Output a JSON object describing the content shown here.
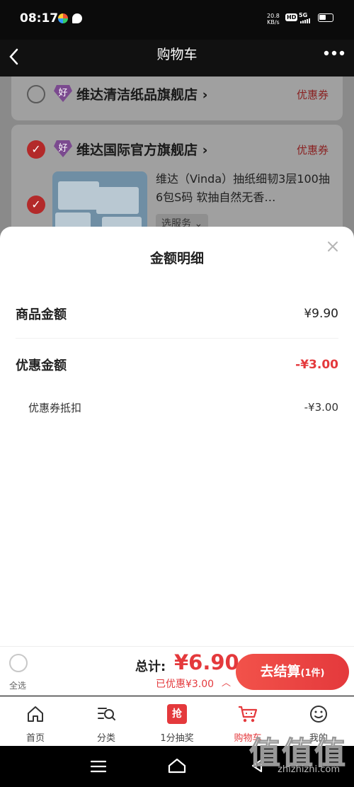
{
  "status_bar": {
    "time": "08:17",
    "network_speed": "20.8",
    "speed_unit": "KB/s",
    "hd_badge": "HD",
    "network_type": "5G"
  },
  "header": {
    "back_icon": "chevron-left-icon",
    "title": "购物车",
    "more_icon": "more-dots-icon"
  },
  "cart": {
    "shops": [
      {
        "name": "维达清洁纸品旗舰店",
        "badge": "好",
        "coupon": "优惠券",
        "selected": false
      },
      {
        "name": "维达国际官方旗舰店",
        "badge": "好",
        "coupon": "优惠券",
        "selected": true
      }
    ],
    "product": {
      "title": "维达（Vinda）抽纸细韧3层100抽6包S码 软抽自然无香…",
      "service_label": "选服务"
    }
  },
  "amount_sheet": {
    "title": "金额明细",
    "close_icon": "close-icon",
    "goods_label": "商品金额",
    "goods_value": "¥9.90",
    "discount_label": "优惠金额",
    "discount_value": "-¥3.00",
    "coupon_label": "优惠券抵扣",
    "coupon_value": "-¥3.00"
  },
  "checkout_bar": {
    "select_all_label": "全选",
    "total_label": "总计:",
    "total_value": "¥6.90",
    "discount_text": "已优惠¥3.00",
    "checkout_label": "去结算",
    "checkout_count": "(1件)"
  },
  "tab_bar": {
    "items": [
      {
        "label": "首页",
        "icon": "home-icon"
      },
      {
        "label": "分类",
        "icon": "category-search-icon"
      },
      {
        "label": "1分抽奖",
        "icon": "lottery-icon",
        "icon_text": "抢"
      },
      {
        "label": "购物车",
        "icon": "cart-icon",
        "active": true
      },
      {
        "label": "我的",
        "icon": "smiley-icon"
      }
    ]
  },
  "watermark": {
    "big": "值值值",
    "small": "zhizhizhi.com"
  },
  "colors": {
    "accent": "#e4393c",
    "dim_overlay": "#8a8a8a"
  }
}
